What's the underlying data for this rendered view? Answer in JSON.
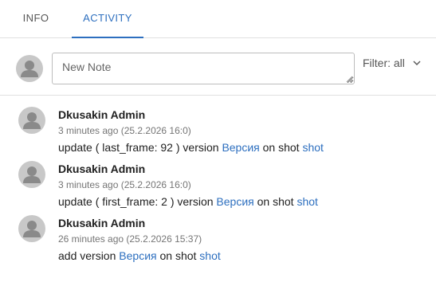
{
  "tabs": [
    {
      "label": "INFO",
      "active": false
    },
    {
      "label": "ACTIVITY",
      "active": true
    }
  ],
  "note": {
    "placeholder": "New Note"
  },
  "filter": {
    "label": "Filter: all"
  },
  "colors": {
    "accent": "#2d6fbf",
    "avatar_bg": "#c8c8c8"
  },
  "activities": [
    {
      "author": "Dkusakin Admin",
      "time": "3 minutes ago (25.2.2026 16:0)",
      "prefix": "update ( last_frame: 92 ) version ",
      "version_link": "Версия",
      "middle": " on shot ",
      "shot_link": "shot"
    },
    {
      "author": "Dkusakin Admin",
      "time": "3 minutes ago (25.2.2026 16:0)",
      "prefix": "update ( first_frame: 2 ) version ",
      "version_link": "Версия",
      "middle": " on shot ",
      "shot_link": "shot"
    },
    {
      "author": "Dkusakin Admin",
      "time": "26 minutes ago (25.2.2026 15:37)",
      "prefix": "add version ",
      "version_link": "Версия",
      "middle": " on shot ",
      "shot_link": "shot"
    }
  ]
}
